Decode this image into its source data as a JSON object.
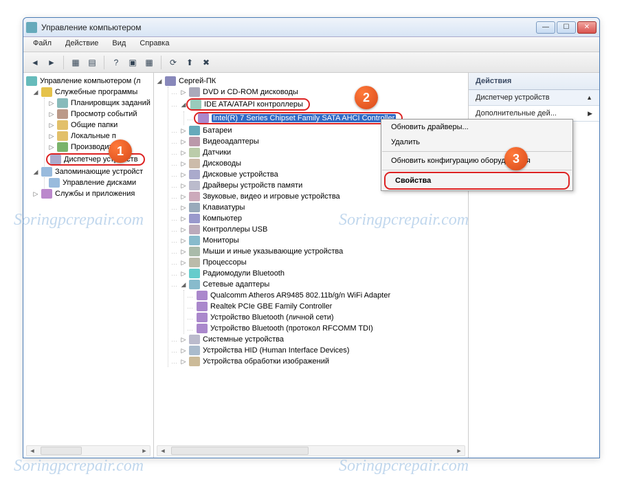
{
  "window": {
    "title": "Управление компьютером"
  },
  "menu": [
    "Файл",
    "Действие",
    "Вид",
    "Справка"
  ],
  "left_tree": {
    "root": "Управление компьютером (л",
    "tools": "Служебные программы",
    "tools_children": [
      "Планировщик заданий",
      "Просмотр событий",
      "Общие папки",
      "Локальные п",
      "Производител"
    ],
    "device_manager": "Диспетчер устройств",
    "storage": "Запоминающие устройст",
    "disk_mgmt": "Управление дисками",
    "services": "Службы и приложения"
  },
  "mid_tree": {
    "root": "Сергей-ПК",
    "categories": [
      {
        "label": "DVD и CD-ROM дисководы",
        "icon": "ic-dvd"
      },
      {
        "label": "IDE ATA/ATAPI контроллеры",
        "icon": "ic-ide",
        "expanded": true,
        "highlighted": true,
        "children": [
          "Intel(R) 7 Series Chipset Family SATA AHCI Controller"
        ]
      },
      {
        "label": "Батареи",
        "icon": "ic-bat"
      },
      {
        "label": "Видеоадаптеры",
        "icon": "ic-vid"
      },
      {
        "label": "Датчики",
        "icon": "ic-sns"
      },
      {
        "label": "Дисководы",
        "icon": "ic-snd"
      },
      {
        "label": "Дисковые устройства",
        "icon": "ic-dsk"
      },
      {
        "label": "Драйверы устройств памяти",
        "icon": "ic-mem"
      },
      {
        "label": "Звуковые, видео и игровые устройства",
        "icon": "ic-aud"
      },
      {
        "label": "Клавиатуры",
        "icon": "ic-kbd"
      },
      {
        "label": "Компьютер",
        "icon": "ic-pc"
      },
      {
        "label": "Контроллеры USB",
        "icon": "ic-usb"
      },
      {
        "label": "Мониторы",
        "icon": "ic-mon"
      },
      {
        "label": "Мыши и иные указывающие устройства",
        "icon": "ic-ms"
      },
      {
        "label": "Процессоры",
        "icon": "ic-cpu"
      },
      {
        "label": "Радиомодули Bluetooth",
        "icon": "ic-bt"
      },
      {
        "label": "Сетевые адаптеры",
        "icon": "ic-net",
        "expanded": true,
        "children": [
          "Qualcomm Atheros AR9485 802.11b/g/n WiFi Adapter",
          "Realtek PCIe GBE Family Controller",
          "Устройство Bluetooth (личной сети)",
          "Устройство Bluetooth (протокол RFCOMM TDI)"
        ]
      },
      {
        "label": "Системные устройства",
        "icon": "ic-sys"
      },
      {
        "label": "Устройства HID (Human Interface Devices)",
        "icon": "ic-hid"
      },
      {
        "label": "Устройства обработки изображений",
        "icon": "ic-img"
      }
    ]
  },
  "context_menu": {
    "items": [
      "Обновить драйверы...",
      "Удалить",
      "Обновить конфигурацию оборудования",
      "Свойства"
    ],
    "highlighted": 3
  },
  "right_pane": {
    "header": "Действия",
    "item_main": "Диспетчер устройств",
    "item_more": "Дополнительные дей..."
  },
  "callouts": {
    "one": "1",
    "two": "2",
    "three": "3"
  },
  "watermark": "Soringpcrepair.com"
}
